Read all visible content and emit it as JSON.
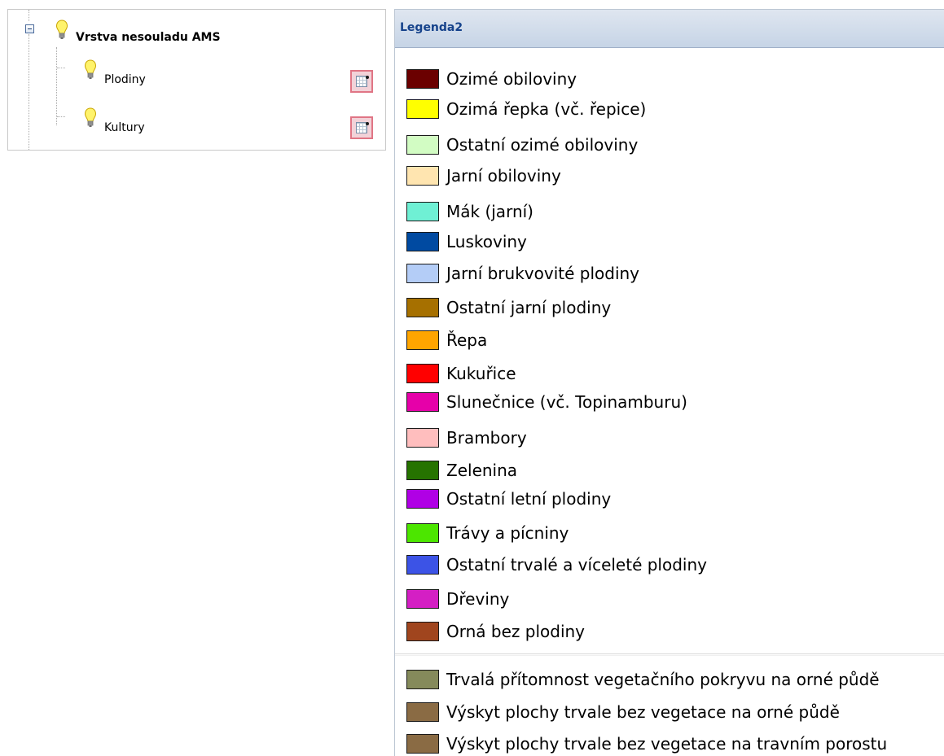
{
  "tree": {
    "root": {
      "label": "Vrstva nesouladu AMS"
    },
    "children": [
      {
        "label": "Plodiny"
      },
      {
        "label": "Kultury"
      }
    ]
  },
  "legend": {
    "title": "Legenda2",
    "items": [
      {
        "label": "Ozimé obiloviny",
        "color": "#6b0000"
      },
      {
        "label": "Ozimá řepka (vč. řepice)",
        "color": "#ffff00"
      },
      {
        "label": "Ostatní ozimé obiloviny",
        "color": "#d2fcc3"
      },
      {
        "label": "Jarní obiloviny",
        "color": "#ffe5b0"
      },
      {
        "label": "Mák (jarní)",
        "color": "#6ff0d4"
      },
      {
        "label": "Luskoviny",
        "color": "#004aa1"
      },
      {
        "label": "Jarní brukvovité plodiny",
        "color": "#b4cdf7"
      },
      {
        "label": "Ostatní jarní plodiny",
        "color": "#a67000"
      },
      {
        "label": "Řepa",
        "color": "#ffa500"
      },
      {
        "label": "Kukuřice",
        "color": "#ff0000"
      },
      {
        "label": "Slunečnice (vč. Topinamburu)",
        "color": "#e600a9"
      },
      {
        "label": "Brambory",
        "color": "#ffbebe"
      },
      {
        "label": "Zelenina",
        "color": "#267300"
      },
      {
        "label": "Ostatní letní plodiny",
        "color": "#b000e5"
      },
      {
        "label": "Trávy a pícniny",
        "color": "#4ce600"
      },
      {
        "label": "Ostatní trvalé a víceleté plodiny",
        "color": "#3c53e6"
      },
      {
        "label": "Dřeviny",
        "color": "#d41fc4"
      },
      {
        "label": "Orná bez plodiny",
        "color": "#a0451e"
      }
    ],
    "extra_items": [
      {
        "label": "Trvalá přítomnost vegetačního pokryvu na orné půdě",
        "color": "#858a5b"
      },
      {
        "label": "Výskyt plochy trvale bez vegetace na orné půdě",
        "color": "#8a6b44"
      },
      {
        "label": "Výskyt plochy trvale bez vegetace na travním porostu",
        "color": "#8a6b44"
      }
    ]
  }
}
